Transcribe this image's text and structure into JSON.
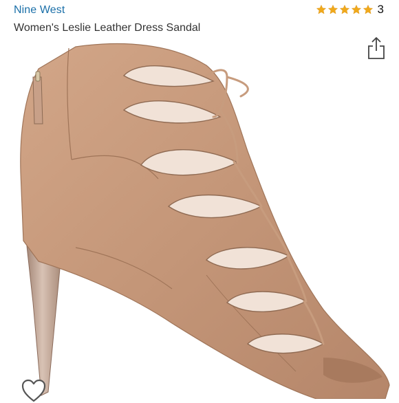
{
  "product": {
    "brand": "Nine West",
    "title": "Women's Leslie Leather Dress Sandal"
  },
  "rating": {
    "stars": 5,
    "count": "3",
    "star_color": "#f0a91b"
  },
  "colors": {
    "brand_link": "#1a6fa8",
    "leather": "#c49678",
    "heel": "#b89a87"
  },
  "icons": {
    "share": "share-icon",
    "favorite": "heart-icon",
    "star": "star-icon"
  }
}
